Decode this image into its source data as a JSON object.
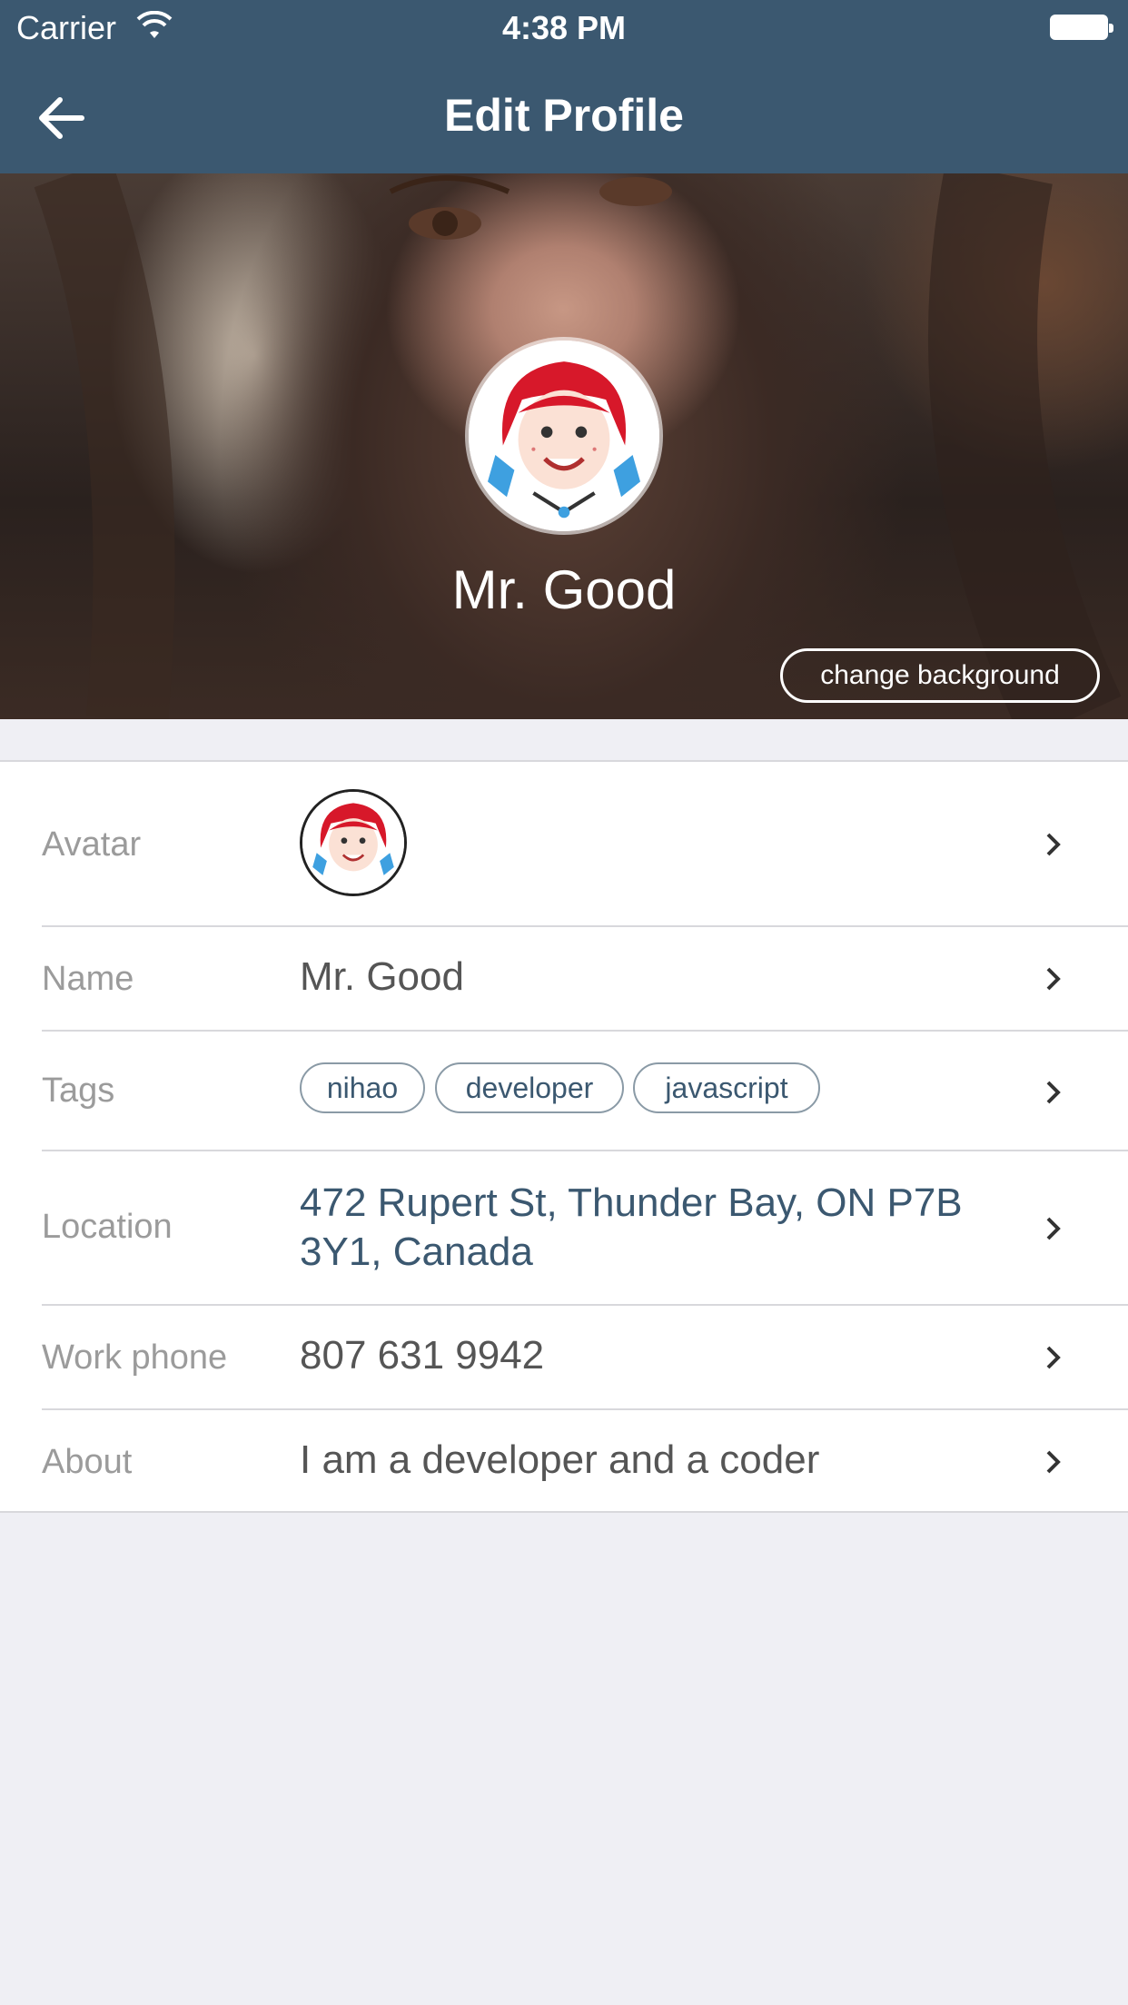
{
  "status_bar": {
    "carrier": "Carrier",
    "time": "4:38 PM"
  },
  "nav": {
    "title": "Edit Profile",
    "back_icon": "arrow-left-icon"
  },
  "hero": {
    "name": "Mr. Good",
    "change_background_label": "change background"
  },
  "rows": {
    "avatar": {
      "label": "Avatar"
    },
    "name": {
      "label": "Name",
      "value": "Mr. Good"
    },
    "tags": {
      "label": "Tags",
      "items": [
        "nihao",
        "developer",
        "javascript"
      ]
    },
    "location": {
      "label": "Location",
      "value": "472 Rupert St, Thunder Bay, ON P7B 3Y1, Canada"
    },
    "work_phone": {
      "label": "Work phone",
      "value": "807 631 9942"
    },
    "about": {
      "label": "About",
      "value": "I am a developer and a coder"
    }
  },
  "colors": {
    "nav_bg": "#3b5870",
    "accent": "#3b5870",
    "page_bg": "#efeff4"
  }
}
